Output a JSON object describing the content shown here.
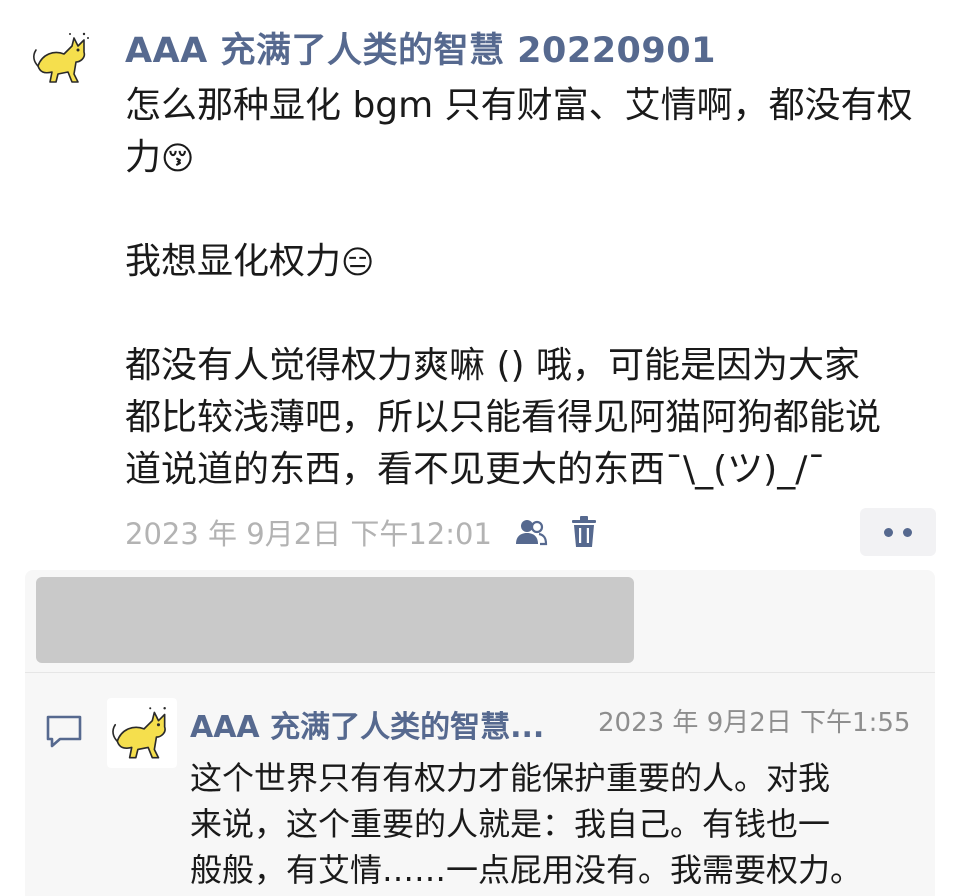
{
  "post": {
    "author": "AAA 充满了人类的智慧 20220901",
    "lines": [
      "怎么那种显化 bgm 只有财富、艾情啊，都没有权",
      "力",
      "我想显化权力",
      "都没有人觉得权力爽嘛 () 哦，可能是因为大家",
      "都比较浅薄吧，所以只能看得见阿猫阿狗都能说",
      "道说道的东西，看不见更大的东西¯\\_(ツ)_/¯"
    ],
    "emojis": [
      "😚",
      "😑"
    ],
    "timestamp": "2023 年 9月2日 下午12:01",
    "icons": [
      "avatar-cat-icon",
      "people-icon",
      "trash-icon",
      "more-dots-icon"
    ]
  },
  "comment": {
    "author": "AAA 充满了人类的智慧...",
    "timestamp": "2023 年 9月2日 下午1:55",
    "lines": [
      "这个世界只有有权力才能保护重要的人。对我",
      "来说，这个重要的人就是：我自己。有钱也一",
      "般般，有艾情……一点屁用没有。我需要权力。"
    ],
    "icons": [
      "comment-bubble-icon"
    ]
  },
  "colors": {
    "accent": "#56698f",
    "text": "#1a1a1a",
    "meta": "#b3b3b3",
    "panel": "#f7f7f7",
    "redacted": "#c9c9c9"
  }
}
